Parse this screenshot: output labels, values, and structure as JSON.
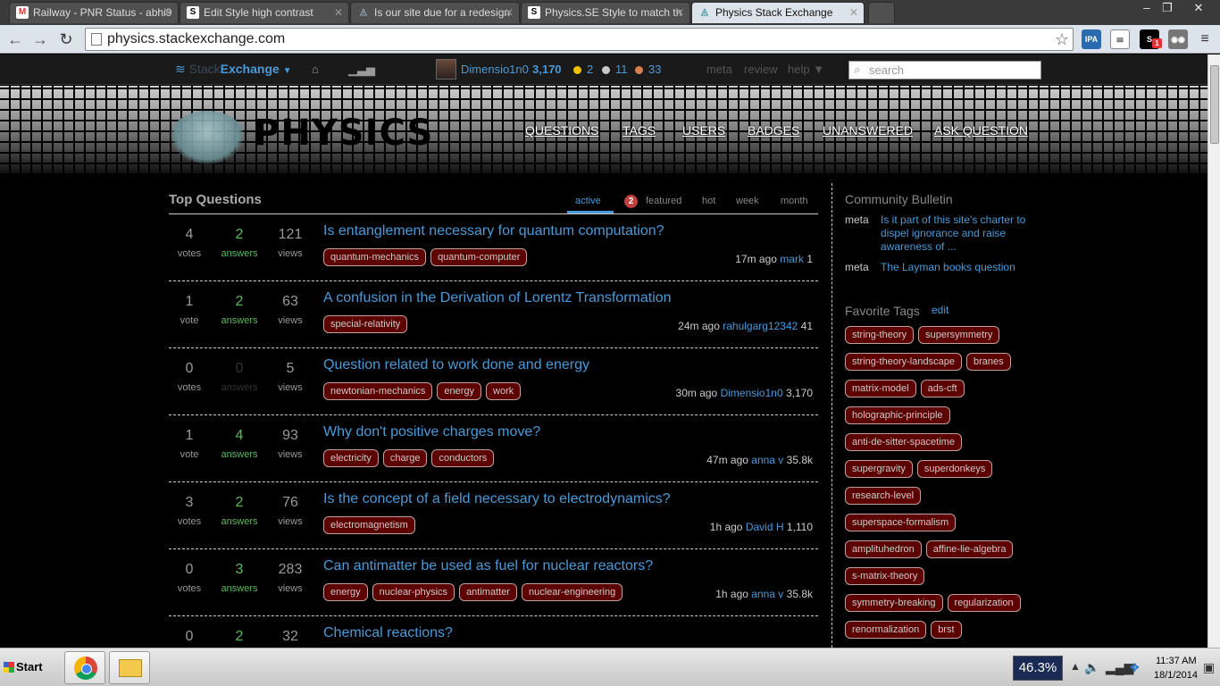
{
  "browser": {
    "tabs": [
      {
        "title": "Railway - PNR Status - abhi9",
        "favicon": "gmail-icon"
      },
      {
        "title": "Edit Style high contrast",
        "favicon": "stylish-icon"
      },
      {
        "title": "Is our site due for a redesign",
        "favicon": "se-icon"
      },
      {
        "title": "Physics.SE Style to match th",
        "favicon": "stylish-icon"
      },
      {
        "title": "Physics Stack Exchange",
        "favicon": "physics-icon"
      }
    ],
    "url": "physics.stackexchange.com",
    "window_controls": {
      "minimize": "–",
      "maximize": "❐",
      "close": "✕"
    },
    "extensions": [
      "IPA",
      "S",
      "1"
    ]
  },
  "topbar": {
    "se_dim": "Stack",
    "se_bright": "Exchange",
    "se_arrow": "▼",
    "user": {
      "name": "Dimensio1n0",
      "rep": "3,170",
      "gold": "2",
      "silver": "11",
      "bronze": "33"
    },
    "links": {
      "meta": "meta",
      "review": "review",
      "help": "help ▼"
    },
    "search_placeholder": "search",
    "colors": {
      "gold": "#f0c000",
      "silver": "#c8c8c8",
      "bronze": "#d88050"
    }
  },
  "header": {
    "site_title": "PHYSICS",
    "nav": [
      "QUESTIONS",
      "TAGS",
      "USERS",
      "BADGES",
      "UNANSWERED",
      "ASK QUESTION"
    ]
  },
  "main": {
    "title": "Top Questions",
    "tabs": {
      "active": "active",
      "featured": "featured",
      "featured_count": "2",
      "hot": "hot",
      "week": "week",
      "month": "month"
    },
    "questions": [
      {
        "votes": "4",
        "votes_label": "votes",
        "answers": "2",
        "answers_label": "answers",
        "views": "121",
        "views_label": "views",
        "title": "Is entanglement necessary for quantum computation?",
        "tags": [
          "quantum-mechanics",
          "quantum-computer"
        ],
        "time": "17m ago",
        "user": "mark",
        "rep": "1"
      },
      {
        "votes": "1",
        "votes_label": "vote",
        "answers": "2",
        "answers_label": "answers",
        "views": "63",
        "views_label": "views",
        "title": "A confusion in the Derivation of Lorentz Transformation",
        "tags": [
          "special-relativity"
        ],
        "time": "24m ago",
        "user": "rahulgarg12342",
        "rep": "41"
      },
      {
        "votes": "0",
        "votes_label": "votes",
        "answers": "0",
        "answers_label": "answers",
        "views": "5",
        "views_label": "views",
        "title": "Question related to work done and energy",
        "tags": [
          "newtonian-mechanics",
          "energy",
          "work"
        ],
        "time": "30m ago",
        "user": "Dimensio1n0",
        "rep": "3,170"
      },
      {
        "votes": "1",
        "votes_label": "vote",
        "answers": "4",
        "answers_label": "answers",
        "views": "93",
        "views_label": "views",
        "title": "Why don't positive charges move?",
        "tags": [
          "electricity",
          "charge",
          "conductors"
        ],
        "time": "47m ago",
        "user": "anna v",
        "rep": "35.8k"
      },
      {
        "votes": "3",
        "votes_label": "votes",
        "answers": "2",
        "answers_label": "answers",
        "views": "76",
        "views_label": "views",
        "title": "Is the concept of a field necessary to electrodynamics?",
        "tags": [
          "electromagnetism"
        ],
        "time": "1h ago",
        "user": "David H",
        "rep": "1,110"
      },
      {
        "votes": "0",
        "votes_label": "votes",
        "answers": "3",
        "answers_label": "answers",
        "views": "283",
        "views_label": "views",
        "title": "Can antimatter be used as fuel for nuclear reactors?",
        "tags": [
          "energy",
          "nuclear-physics",
          "antimatter",
          "nuclear-engineering"
        ],
        "time": "1h ago",
        "user": "anna v",
        "rep": "35.8k"
      },
      {
        "votes": "0",
        "votes_label": "",
        "answers": "2",
        "answers_label": "",
        "views": "32",
        "views_label": "",
        "title": "Chemical reactions?",
        "tags": [],
        "time": "",
        "user": "",
        "rep": ""
      }
    ]
  },
  "sidebar": {
    "bulletin_title": "Community Bulletin",
    "bulletin": [
      {
        "label": "meta",
        "text": "Is it part of this site's charter to dispel ignorance and raise awareness of ..."
      },
      {
        "label": "meta",
        "text": "The Layman books question"
      }
    ],
    "fav_title": "Favorite Tags",
    "fav_edit": "edit",
    "fav_tags": [
      [
        "string-theory",
        "supersymmetry"
      ],
      [
        "string-theory-landscape",
        "branes"
      ],
      [
        "matrix-model",
        "ads-cft"
      ],
      [
        "holographic-principle"
      ],
      [
        "anti-de-sitter-spacetime"
      ],
      [
        "supergravity",
        "superdonkeys"
      ],
      [
        "research-level"
      ],
      [
        "superspace-formalism"
      ],
      [
        "amplituhedron",
        "affine-lie-algebra"
      ],
      [
        "s-matrix-theory"
      ],
      [
        "symmetry-breaking",
        "regularization"
      ],
      [
        "renormalization",
        "brst"
      ]
    ]
  },
  "taskbar": {
    "start": "Start",
    "cpu": "46.3%",
    "time": "11:37 AM",
    "date": "18/1/2014"
  }
}
